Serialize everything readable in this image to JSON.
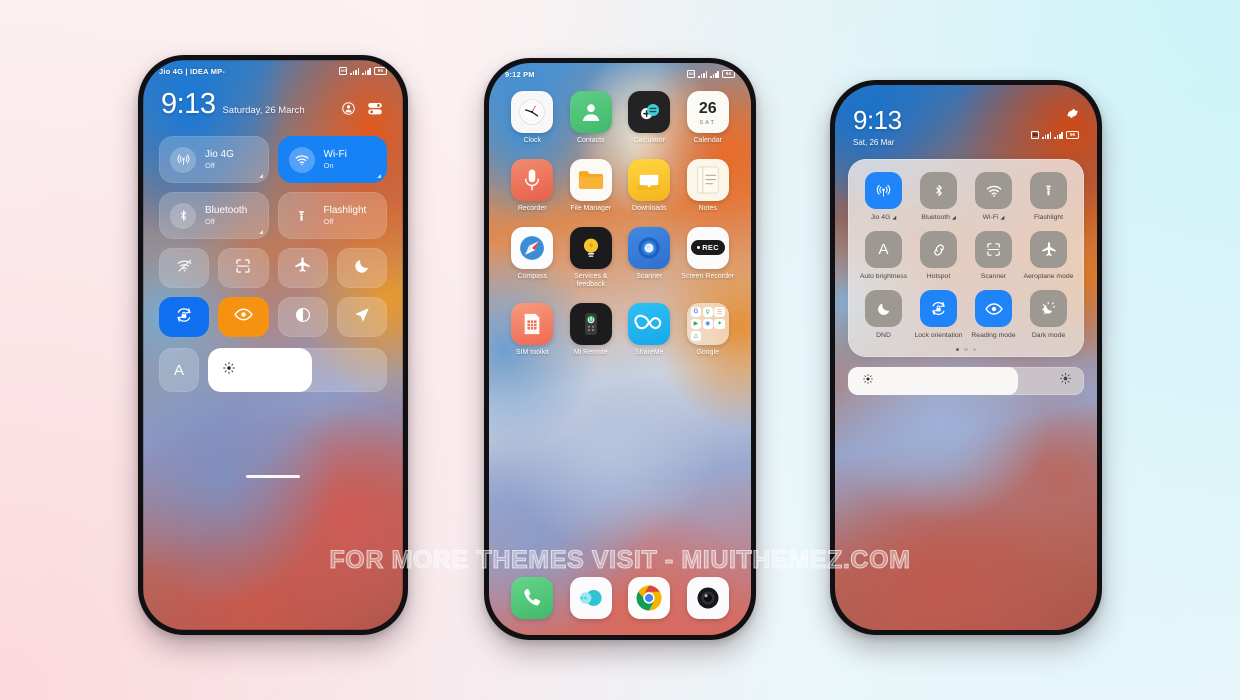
{
  "watermark": "FOR MORE THEMES VISIT - MIUITHEMEZ.COM",
  "colors": {
    "accent_blue": "#1782f5",
    "accent_orange": "#f59211",
    "tile_grey": "#9e9892",
    "panel_bg": "#f2eeea"
  },
  "phone1": {
    "status_bar": {
      "carrier": "Jio 4G | IDEA MP-",
      "battery": "96"
    },
    "clock": "9:13",
    "date": "Saturday, 26 March",
    "actions": [
      {
        "name": "user-icon",
        "label": "User"
      },
      {
        "name": "settings-toggles-icon",
        "label": "Edit toggles"
      }
    ],
    "big_tiles": [
      {
        "name": "Jio 4G",
        "state": "Off",
        "active": false,
        "icon": "cellular-icon"
      },
      {
        "name": "Wi-Fi",
        "state": "On",
        "active": true,
        "icon": "wifi-icon"
      },
      {
        "name": "Bluetooth",
        "state": "Off",
        "active": false,
        "icon": "bluetooth-icon"
      },
      {
        "name": "Flashlight",
        "state": "Off",
        "active": false,
        "icon": "flashlight-icon"
      }
    ],
    "small_tiles": [
      {
        "icon": "wifi-off-icon",
        "label": "Wi-Fi hotspot",
        "style": "plain"
      },
      {
        "icon": "scanner-icon",
        "label": "Scanner",
        "style": "plain"
      },
      {
        "icon": "aeroplane-icon",
        "label": "Aeroplane mode",
        "style": "plain"
      },
      {
        "icon": "moon-icon",
        "label": "DND",
        "style": "plain"
      },
      {
        "icon": "lock-orientation-icon",
        "label": "Lock orientation",
        "style": "blue"
      },
      {
        "icon": "reading-mode-icon",
        "label": "Reading mode",
        "style": "orange"
      },
      {
        "icon": "dark-mode-icon",
        "label": "Dark mode",
        "style": "plain"
      },
      {
        "icon": "location-icon",
        "label": "Location",
        "style": "plain"
      }
    ],
    "auto_brightness": "A",
    "brightness_percent": 58
  },
  "phone2": {
    "status_bar": {
      "time": "9:12 PM",
      "battery": "96"
    },
    "apps": [
      {
        "label": "Clock",
        "icon": "clock-app-icon"
      },
      {
        "label": "Contacts",
        "icon": "contacts-app-icon"
      },
      {
        "label": "Calculator",
        "icon": "calculator-app-icon"
      },
      {
        "label": "Calendar",
        "icon": "calendar-app-icon",
        "day": "26",
        "weekday": "SAT"
      },
      {
        "label": "Recorder",
        "icon": "recorder-app-icon"
      },
      {
        "label": "File Manager",
        "icon": "file-manager-app-icon"
      },
      {
        "label": "Downloads",
        "icon": "downloads-app-icon"
      },
      {
        "label": "Notes",
        "icon": "notes-app-icon"
      },
      {
        "label": "Compass",
        "icon": "compass-app-icon"
      },
      {
        "label": "Services & feedback",
        "icon": "services-feedback-app-icon"
      },
      {
        "label": "Scanner",
        "icon": "scanner-app-icon"
      },
      {
        "label": "Screen Recorder",
        "icon": "screen-recorder-app-icon",
        "badge": "REC"
      },
      {
        "label": "SIM toolkit",
        "icon": "sim-toolkit-app-icon"
      },
      {
        "label": "Mi Remote",
        "icon": "mi-remote-app-icon"
      },
      {
        "label": "ShareMe",
        "icon": "shareme-app-icon"
      },
      {
        "label": "Google",
        "icon": "google-folder-icon"
      }
    ],
    "dock": [
      {
        "label": "Phone",
        "icon": "phone-app-icon"
      },
      {
        "label": "Messages",
        "icon": "messages-app-icon"
      },
      {
        "label": "Chrome",
        "icon": "chrome-app-icon"
      },
      {
        "label": "Camera",
        "icon": "camera-app-icon"
      }
    ]
  },
  "phone3": {
    "clock": "9:13",
    "date": "Sat, 26 Mar",
    "battery": "96",
    "settings_icon": "gear-icon",
    "toggles": [
      {
        "label": "Jio 4G",
        "icon": "cellular-icon",
        "active": true,
        "arrow": true
      },
      {
        "label": "Bluetooth",
        "icon": "bluetooth-icon",
        "active": false,
        "arrow": true
      },
      {
        "label": "Wi-Fi",
        "icon": "wifi-icon",
        "active": false,
        "arrow": true
      },
      {
        "label": "Flashlight",
        "icon": "flashlight-icon",
        "active": false,
        "arrow": false
      },
      {
        "label": "Auto brightness",
        "icon": "auto-brightness-icon",
        "active": false,
        "arrow": false
      },
      {
        "label": "Hotspot",
        "icon": "hotspot-icon",
        "active": false,
        "arrow": false
      },
      {
        "label": "Scanner",
        "icon": "scanner-icon",
        "active": false,
        "arrow": false
      },
      {
        "label": "Aeroplane mode",
        "icon": "aeroplane-icon",
        "active": false,
        "arrow": false
      },
      {
        "label": "DND",
        "icon": "moon-icon",
        "active": false,
        "arrow": false
      },
      {
        "label": "Lock orientation",
        "icon": "lock-orientation-icon",
        "active": true,
        "arrow": false
      },
      {
        "label": "Reading mode",
        "icon": "reading-mode-icon",
        "active": true,
        "arrow": false
      },
      {
        "label": "Dark mode",
        "icon": "dark-mode-icon",
        "active": false,
        "arrow": false
      }
    ],
    "page_dots": {
      "count": 3,
      "active_index": 0
    },
    "brightness_percent": 72
  }
}
